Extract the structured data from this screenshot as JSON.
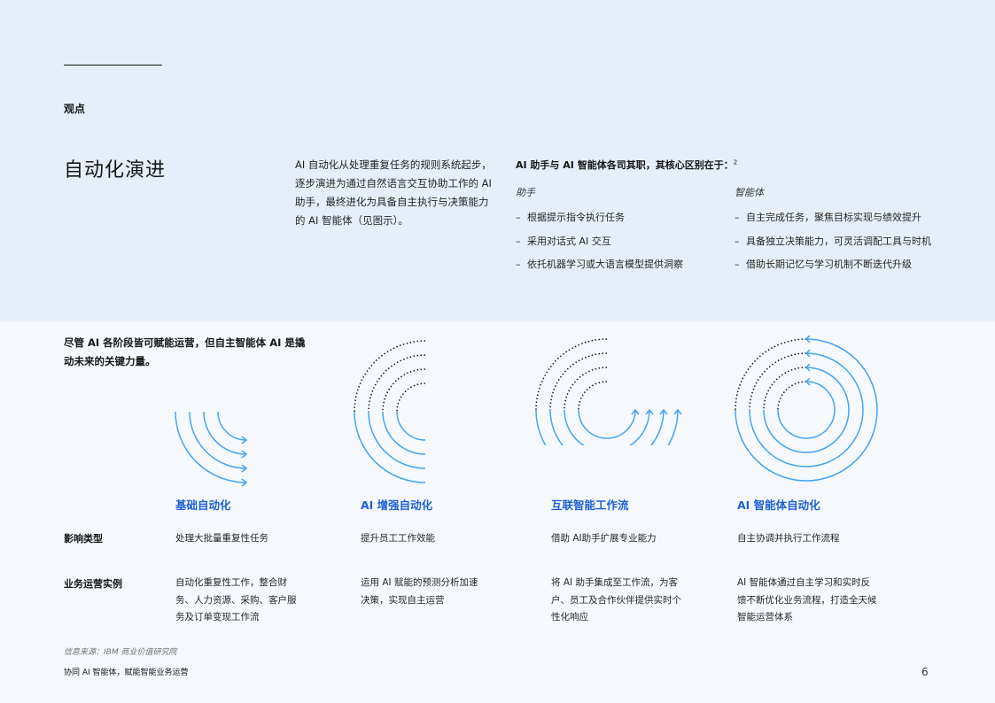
{
  "section_label": "观点",
  "title": "自动化演进",
  "intro": "AI 自动化从处理重复任务的规则系统起步，逐步演进为通过自然语言交互协助工作的 AI 助手，最终进化为具备自主执行与决策能力的 AI 智能体（见图示）。",
  "compare": {
    "title": "AI 助手与 AI 智能体各司其职，其核心区别在于：",
    "footnote": "2",
    "assistant": {
      "label": "助手",
      "items": [
        "根据提示指令执行任务",
        "采用对话式 AI 交互",
        "依托机器学习或大语言模型提供洞察"
      ]
    },
    "agent": {
      "label": "智能体",
      "items": [
        "自主完成任务，聚焦目标实现与绩效提升",
        "具备独立决策能力，可灵活调配工具与时机",
        "借助长期记忆与学习机制不断迭代升级"
      ]
    }
  },
  "statement": "尽管 AI 各阶段皆可赋能运营，但自主智能体 AI 是撬动未来的关键力量。",
  "stages": [
    {
      "title": "基础自动化",
      "icon": "quarter-arcs-arrows-icon",
      "impact": "处理大批量重复性任务",
      "example": "自动化重复性工作，整合财务、人力资源、采购、客户服务及订单变现工作流"
    },
    {
      "title": "AI 增强自动化",
      "icon": "half-arcs-dotted-icon",
      "impact": "提升员工工作效能",
      "example": "运用 AI 赋能的预测分析加速决策，实现自主运营"
    },
    {
      "title": "互联智能工作流",
      "icon": "three-quarter-arcs-arrows-icon",
      "impact": "借助 AI助手扩展专业能力",
      "example": "将 AI 助手集成至工作流，为客户、员工及合作伙伴提供实时个性化响应"
    },
    {
      "title": "AI 智能体自动化",
      "icon": "full-circles-arrows-icon",
      "impact": "自主协调并执行工作流程",
      "example": "AI 智能体通过自主学习和实时反馈不断优化业务流程，打造全天候智能运营体系"
    }
  ],
  "row_labels": {
    "impact": "影响类型",
    "example": "业务运营实例"
  },
  "source": "信息来源：IBM 商业价值研究院",
  "footer": "协同 AI 智能体，赋能智能业务运营",
  "page_number": "6",
  "colors": {
    "accent_blue": "#1f5fd6",
    "arc_blue": "#45a3f5",
    "band": "#e6eff9"
  }
}
